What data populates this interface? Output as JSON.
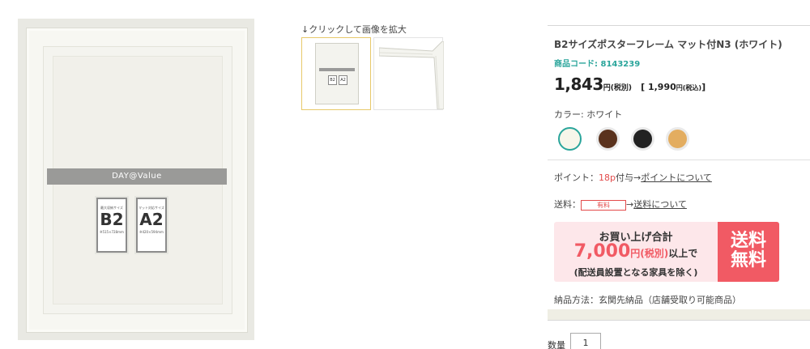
{
  "product_image": {
    "brand": "DAY@Value",
    "cards": [
      {
        "header": "最大収納サイズ",
        "size": "B2",
        "dimensions": "※515×728mm"
      },
      {
        "header": "マット対応サイズ",
        "size": "A2",
        "dimensions": "※420×594mm"
      }
    ]
  },
  "thumbnails": {
    "caption": "↓クリックして画像を拡大",
    "items": [
      {
        "label": "B2",
        "label2": "A2"
      },
      {}
    ]
  },
  "product": {
    "title": "B2サイズポスターフレーム マット付N3 (ホワイト)",
    "code": "商品コード: 8143239",
    "price": "1,843",
    "price_unit": "円(税別)",
    "price_incl_prefix": "[",
    "price_incl": "1,990",
    "price_incl_unit": "円(税込)",
    "price_incl_suffix": "]",
    "color_label": "カラー: ホワイト",
    "colors": [
      {
        "name": "ホワイト",
        "hex": "#f7f6ea",
        "selected": true
      },
      {
        "name": "ブラウン",
        "hex": "#5a321d"
      },
      {
        "name": "ブラック",
        "hex": "#222222"
      },
      {
        "name": "ナチュラル",
        "hex": "#e3ad60"
      }
    ],
    "points_prefix": "ポイント：",
    "points_value": "18p",
    "points_suffix": "付与→",
    "points_link": "ポイントについて",
    "shipping_prefix": "送料：",
    "shipping_badge": "有料",
    "shipping_arrow": "→",
    "shipping_link": "送料について",
    "delivery": "納品方法：玄関先納品（店舗受取り可能商品）"
  },
  "promo": {
    "line1": "お買い上げ合計",
    "amount": "7,000",
    "unit": "円(税別)",
    "above": "以上で",
    "note": "(配送員設置となる家具を除く)",
    "badge_line1": "送料",
    "badge_line2": "無料",
    "accent": "#f15a64"
  },
  "quantity": {
    "label": "数量",
    "value": "1"
  }
}
